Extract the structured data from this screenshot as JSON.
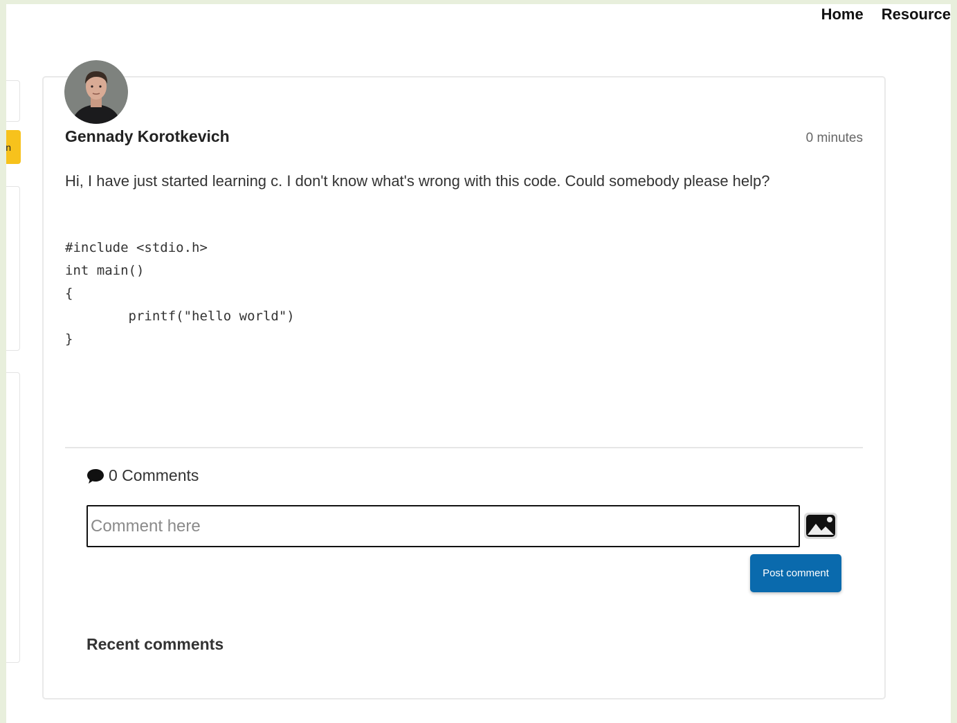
{
  "nav": {
    "items": [
      "Home",
      "Resource"
    ]
  },
  "sidebar": {
    "button_label": "n"
  },
  "post": {
    "author": "Gennady Korotkevich",
    "time": "0 minutes",
    "text": "Hi, I have just started learning c. I don't know what's wrong with this code. Could somebody please help?",
    "code": "#include <stdio.h>\nint main()\n{\n        printf(\"hello world\")\n}"
  },
  "comments": {
    "count_label": "0 Comments",
    "input_placeholder": "Comment here",
    "post_button": "Post comment",
    "recent_title": "Recent comments"
  },
  "colors": {
    "accent": "#0a6aad",
    "sidebar_button": "#f7c21c",
    "page_frame": "#e8efdc"
  },
  "icons": {
    "comment": "speech-bubble-icon",
    "upload": "image-upload-icon"
  }
}
